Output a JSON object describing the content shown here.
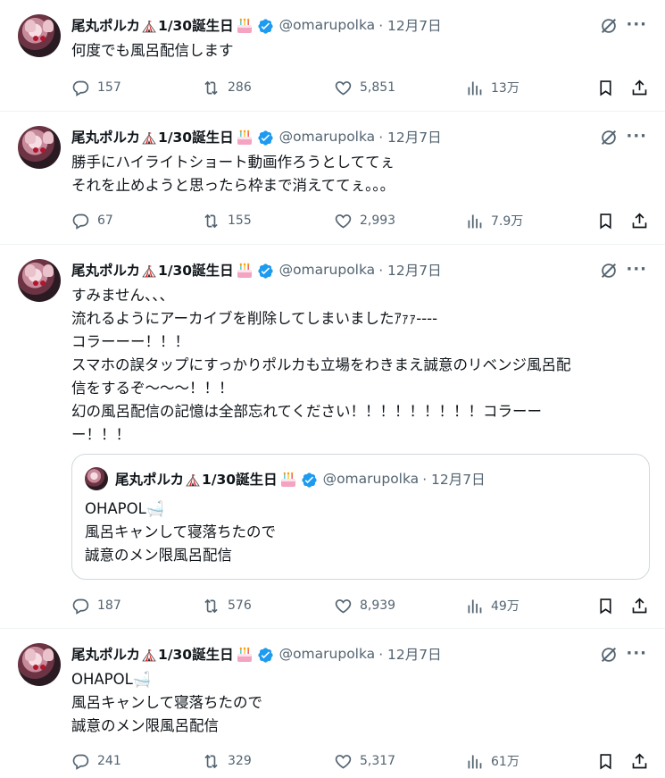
{
  "colors": {
    "text": "#0f1419",
    "muted": "#536471",
    "verified": "#1d9bf0",
    "border": "#eff3f4"
  },
  "tweets": [
    {
      "author": "尾丸ポルカ",
      "birthday": "1/30誕生日",
      "handle": "@omarupolka",
      "date": "· 12月7日",
      "text": "何度でも風呂配信します",
      "replies": "157",
      "retweets": "286",
      "likes": "5,851",
      "views": "13万"
    },
    {
      "author": "尾丸ポルカ",
      "birthday": "1/30誕生日",
      "handle": "@omarupolka",
      "date": "· 12月7日",
      "text": "勝手にハイライトショート動画作ろうとしててぇ\nそれを止めようと思ったら枠まで消えててぇ。。。",
      "replies": "67",
      "retweets": "155",
      "likes": "2,993",
      "views": "7.9万"
    },
    {
      "author": "尾丸ポルカ",
      "birthday": "1/30誕生日",
      "handle": "@omarupolka",
      "date": "· 12月7日",
      "text": "すみません、、、\n流れるようにアーカイブを削除してしまいましたｱｧｧ----\nコラーーー！！！\nスマホの誤タップにすっかりポルカも立場をわきまえ誠意のリベンジ風呂配\n信をするぞ〜〜〜！！！\n幻の風呂配信の記憶は全部忘れてください！！！！！！！！！コラーー\nー！！！",
      "quote": {
        "author": "尾丸ポルカ",
        "birthday": "1/30誕生日",
        "handle": "@omarupolka",
        "date": "· 12月7日",
        "text": "OHAPOL🛁\n風呂キャンして寝落ちたので\n誠意のメン限風呂配信"
      },
      "replies": "187",
      "retweets": "576",
      "likes": "8,939",
      "views": "49万"
    },
    {
      "author": "尾丸ポルカ",
      "birthday": "1/30誕生日",
      "handle": "@omarupolka",
      "date": "· 12月7日",
      "text": "OHAPOL🛁\n風呂キャンして寝落ちたので\n誠意のメン限風呂配信",
      "replies": "241",
      "retweets": "329",
      "likes": "5,317",
      "views": "61万"
    }
  ]
}
